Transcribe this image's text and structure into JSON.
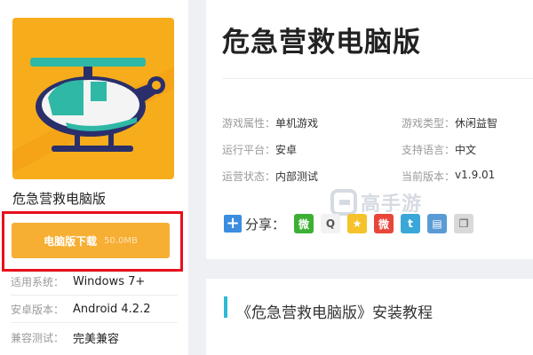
{
  "app": {
    "name": "危急营救电脑版",
    "download_label": "电脑版下载",
    "download_size": "50.0MB",
    "meta": [
      {
        "label": "适用系统：",
        "value": "Windows 7+"
      },
      {
        "label": "安卓版本：",
        "value": "Android 4.2.2"
      },
      {
        "label": "兼容测试：",
        "value": "完美兼容"
      }
    ]
  },
  "detail": {
    "title": "危急营救电脑版",
    "attributes": [
      {
        "label": "游戏属性：",
        "value": "单机游戏"
      },
      {
        "label": "游戏类型：",
        "value": "休闲益智"
      },
      {
        "label": "运行平台：",
        "value": "安卓"
      },
      {
        "label": "支持语言：",
        "value": "中文"
      },
      {
        "label": "运营状态：",
        "value": "内部测试"
      },
      {
        "label": "当前版本：",
        "value": "v1.9.01"
      }
    ]
  },
  "watermark": {
    "text": "高手游"
  },
  "share": {
    "label": "分享：",
    "plus": "+",
    "icons": [
      {
        "name": "wechat-icon",
        "color": "#3cb034",
        "glyph": "微"
      },
      {
        "name": "qq-icon",
        "color": "#f2f2f2",
        "glyph": "Q"
      },
      {
        "name": "qzone-icon",
        "color": "#f6c22b",
        "glyph": "★"
      },
      {
        "name": "weibo-icon",
        "color": "#e8463b",
        "glyph": "微"
      },
      {
        "name": "tencent-weibo-icon",
        "color": "#39a8d8",
        "glyph": "t"
      },
      {
        "name": "print-icon",
        "color": "#5a9bd6",
        "glyph": "▤"
      },
      {
        "name": "copy-icon",
        "color": "#d9d9d9",
        "glyph": "❐"
      }
    ]
  },
  "tutorial": {
    "title": "《危急营救电脑版》安装教程"
  },
  "colors": {
    "accent_orange": "#f6ae33",
    "highlight_red": "#e8101c",
    "section_bar": "#2dbad6"
  }
}
